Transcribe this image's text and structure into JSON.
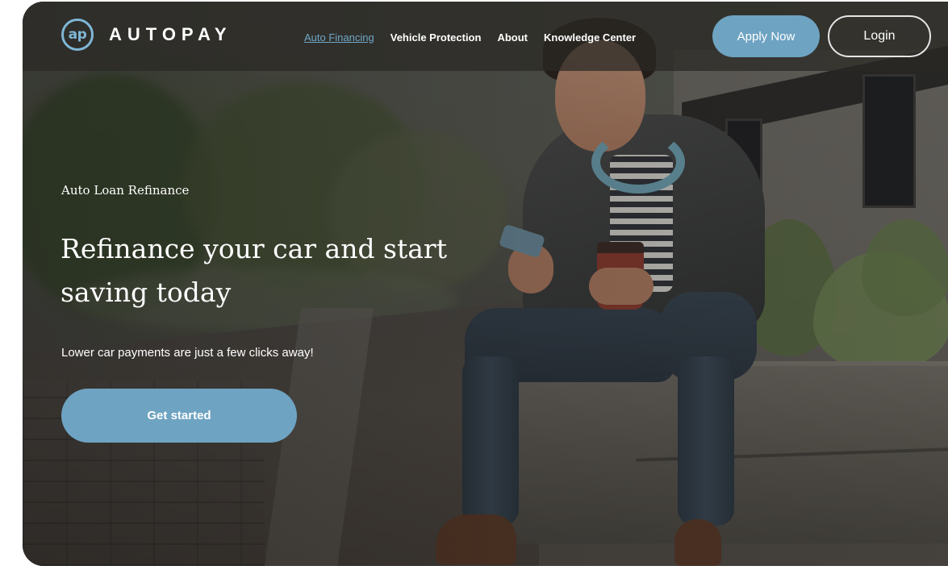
{
  "brand": {
    "logo_mark": "ap",
    "name": "AUTOPAY",
    "accent_color": "#6ea3c2"
  },
  "nav": {
    "links": [
      {
        "label": "Auto Financing",
        "active": true
      },
      {
        "label": "Vehicle Protection",
        "active": false
      },
      {
        "label": "About",
        "active": false
      },
      {
        "label": "Knowledge Center",
        "active": false
      }
    ],
    "apply_label": "Apply Now",
    "login_label": "Login"
  },
  "hero": {
    "eyebrow": "Auto Loan Refinance",
    "title": "Refinance your car and start saving today",
    "subtitle": "Lower car payments are just a few clicks away!",
    "cta_label": "Get started"
  }
}
